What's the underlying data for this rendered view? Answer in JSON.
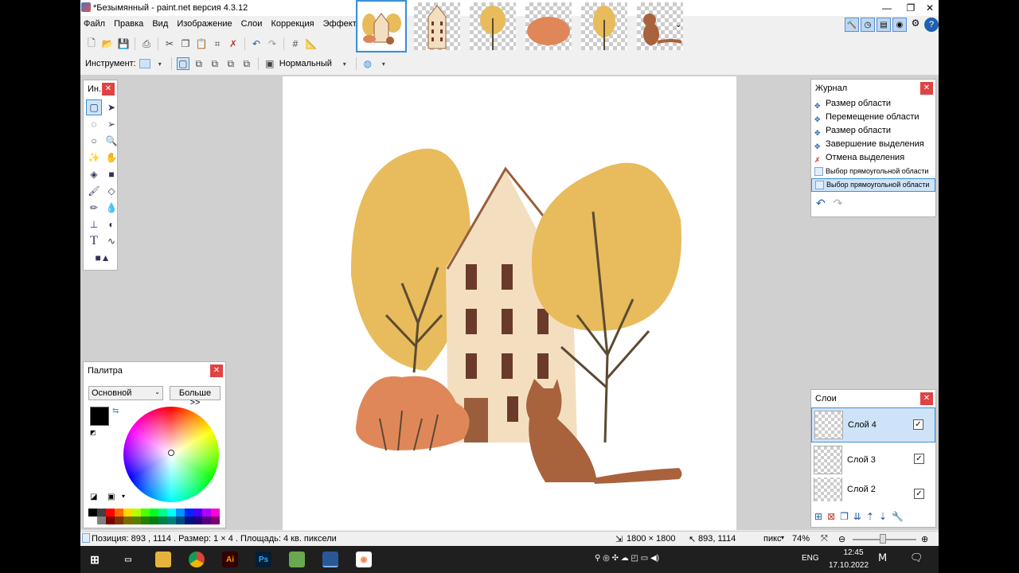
{
  "window": {
    "title": "*Безымянный - paint.net версия 4.3.12",
    "min": "—",
    "max": "❐",
    "close": "✕"
  },
  "menu": [
    "Файл",
    "Правка",
    "Вид",
    "Изображение",
    "Слои",
    "Коррекция",
    "Эффекты"
  ],
  "toolbar2": {
    "tool_label": "Инструмент:",
    "blend_mode": "Нормальный"
  },
  "tools_panel": {
    "title": "Ин..."
  },
  "history": {
    "title": "Журнал",
    "items": [
      "Размер области",
      "Перемещение области",
      "Размер области",
      "Завершение выделения",
      "Отмена выделения",
      "Выбор прямоугольной области",
      "Выбор прямоугольной области"
    ]
  },
  "palette": {
    "title": "Палитра",
    "mode": "Основной",
    "more_button": "Больше >>",
    "primary_color": "#000000",
    "secondary_color": "#ffffff"
  },
  "layers": {
    "title": "Слои",
    "items": [
      "Слой 4",
      "Слой 3",
      "Слой 2"
    ]
  },
  "status": {
    "position": "Позиция: 893 , 1114 . Размер: 1  × 4 . Площадь: 4 кв. пиксели",
    "image_size": "1800 × 1800",
    "cursor": "893, 1114",
    "units": "пикс",
    "zoom": "74%"
  },
  "taskbar": {
    "lang": "ENG",
    "time": "12:45",
    "date": "17.10.2022"
  },
  "colors": {
    "tree_yellow": "#e8bb5c",
    "house_cream": "#f3dfc0",
    "roof_brown": "#9a5e3c",
    "window_brown": "#6b3a2a",
    "bush_orange": "#e0875a",
    "cat_brown": "#a8623c",
    "trunk": "#5b4a32"
  }
}
